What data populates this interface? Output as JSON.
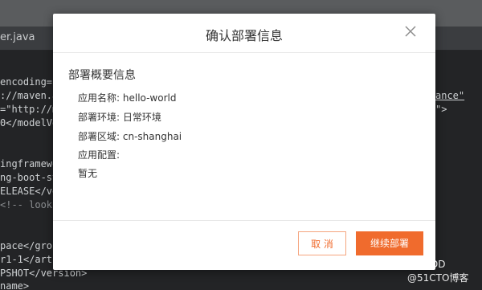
{
  "editor": {
    "tab_label": "er.java",
    "lines": [
      "encoding=\"",
      "://maven.a",
      "=\"http://m",
      "0</modelVe",
      "",
      "",
      "ingframewo",
      "ng-boot-st",
      "ELEASE</ve",
      "<!-- looku",
      "",
      "",
      "pace</grou",
      "r1-1</arti",
      "PSHOT</version>",
      "name>"
    ],
    "right_fragments": {
      "line2": "ance\"",
      "line3": "\">"
    }
  },
  "dialog": {
    "title": "确认部署信息",
    "section_title": "部署概要信息",
    "rows": [
      {
        "label": "应用名称:",
        "value": "hello-world"
      },
      {
        "label": "部署环境:",
        "value": "日常环境"
      },
      {
        "label": "部署区域:",
        "value": "cn-shanghai"
      },
      {
        "label": "应用配置:",
        "value": ""
      },
      {
        "label": "暂无",
        "value": ""
      }
    ],
    "cancel_label": "取 消",
    "confirm_label": "继续部署"
  },
  "watermark": {
    "line1": "程序猿DD",
    "line2": "@51CTO博客"
  },
  "colors": {
    "accent": "#f06b2d",
    "editor_bg": "#232426",
    "dialog_bg": "#ffffff"
  }
}
